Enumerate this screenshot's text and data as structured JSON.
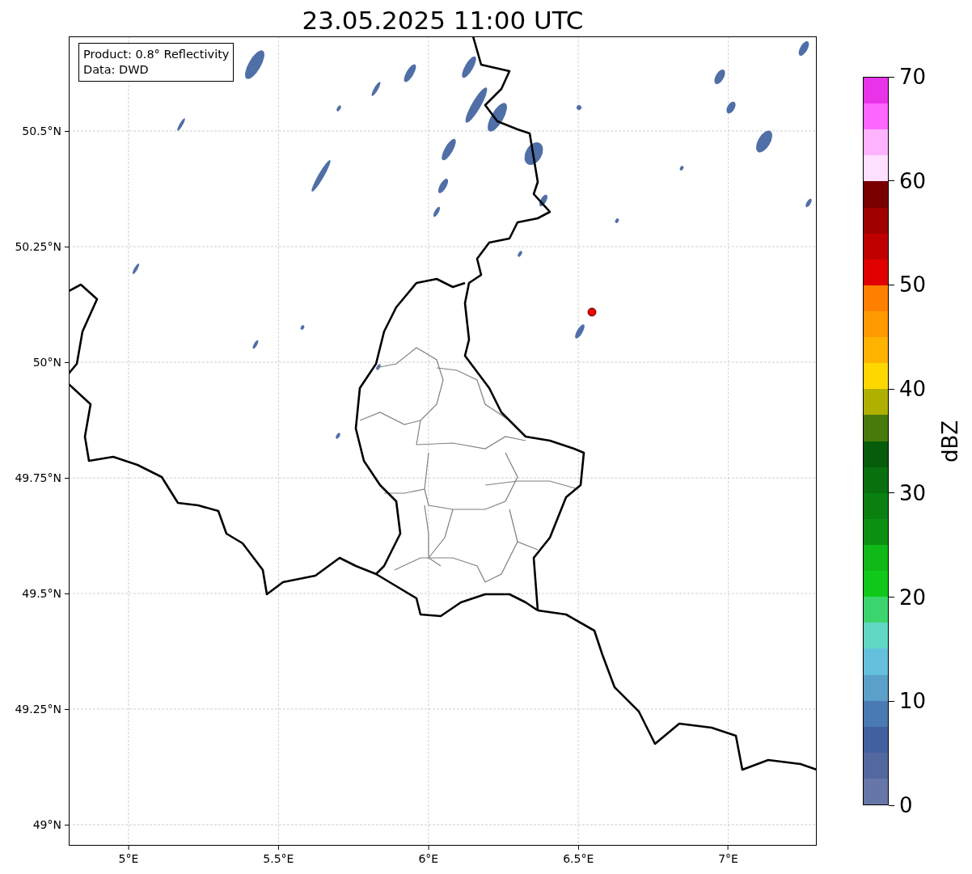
{
  "title": "23.05.2025 11:00 UTC",
  "legend": [
    "Product: 0.8° Reflectivity",
    "Data: DWD"
  ],
  "lat_ticks": [
    "50.5°N",
    "50.25°N",
    "50°N",
    "49.75°N",
    "49.5°N",
    "49.25°N",
    "49°N"
  ],
  "lon_ticks": [
    "5°E",
    "5.5°E",
    "6°E",
    "6.5°E",
    "7°E"
  ],
  "colorbar": {
    "label": "dBZ",
    "ticks": [
      "70",
      "60",
      "50",
      "40",
      "30",
      "20",
      "10",
      "0"
    ],
    "bins": [
      {
        "color": "#e833e8"
      },
      {
        "color": "#ff66ff"
      },
      {
        "color": "#ffb3ff"
      },
      {
        "color": "#ffe0ff"
      },
      {
        "color": "#780000"
      },
      {
        "color": "#a00000"
      },
      {
        "color": "#c00000"
      },
      {
        "color": "#e00000"
      },
      {
        "color": "#ff8000"
      },
      {
        "color": "#ff9900"
      },
      {
        "color": "#ffb300"
      },
      {
        "color": "#ffd700"
      },
      {
        "color": "#b0b000"
      },
      {
        "color": "#467a0a"
      },
      {
        "color": "#065c0a"
      },
      {
        "color": "#08700e"
      },
      {
        "color": "#0a8010"
      },
      {
        "color": "#0c9012"
      },
      {
        "color": "#10b818"
      },
      {
        "color": "#10c81a"
      },
      {
        "color": "#3cd46e"
      },
      {
        "color": "#60d8c4"
      },
      {
        "color": "#64c0dc"
      },
      {
        "color": "#5aa0c8"
      },
      {
        "color": "#4a7ab4"
      },
      {
        "color": "#4260a0"
      },
      {
        "color": "#5468a0"
      },
      {
        "color": "#6676a8"
      }
    ]
  }
}
